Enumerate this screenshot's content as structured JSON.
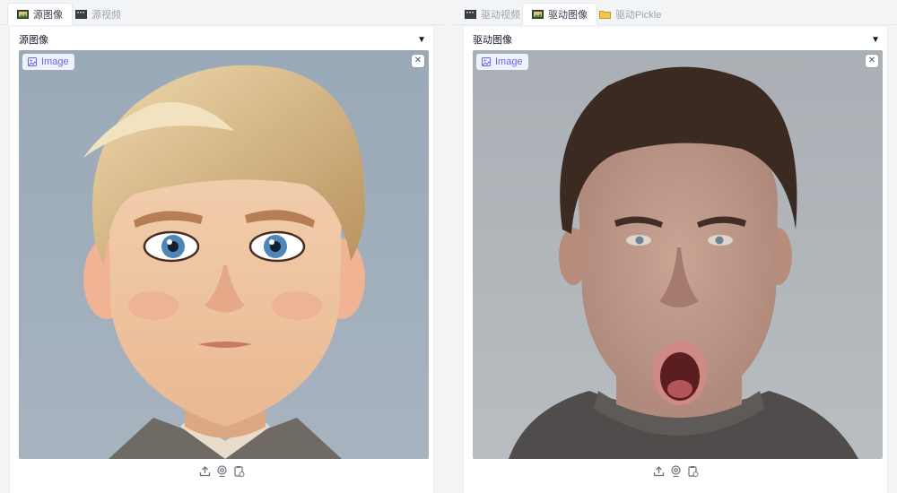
{
  "left": {
    "tabs": [
      {
        "label": "源图像",
        "icon": "image-file-icon",
        "active": true
      },
      {
        "label": "源视频",
        "icon": "video-file-icon",
        "active": false
      }
    ],
    "panel_label": "源图像",
    "badge_label": "Image",
    "image_description": "cartoon-boy-portrait"
  },
  "right": {
    "tabs": [
      {
        "label": "驱动视频",
        "icon": "video-file-icon",
        "active": false
      },
      {
        "label": "驱动图像",
        "icon": "image-file-icon",
        "active": true
      },
      {
        "label": "驱动Pickle",
        "icon": "folder-icon",
        "active": false
      }
    ],
    "panel_label": "驱动图像",
    "badge_label": "Image",
    "image_description": "man-open-mouth-photo"
  },
  "controls": {
    "collapse_icon": "caret-down-icon",
    "clear_icon": "close-icon",
    "tool_icons": [
      "upload-icon",
      "webcam-icon",
      "clipboard-icon"
    ]
  },
  "colors": {
    "accent": "#6366f1",
    "badge_bg": "#eef2ff",
    "page_bg": "#f3f4f6"
  }
}
